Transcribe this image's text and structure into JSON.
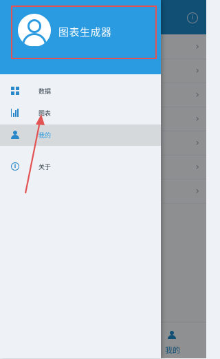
{
  "app": {
    "title": "图表生成器"
  },
  "drawer": {
    "items": [
      {
        "label": "数据",
        "icon": "grid-icon",
        "active": false
      },
      {
        "label": "图表",
        "icon": "bar-chart-icon",
        "active": false
      },
      {
        "label": "我的",
        "icon": "person-icon",
        "active": true
      },
      {
        "label": "关于",
        "icon": "info-icon",
        "active": false
      }
    ]
  },
  "background": {
    "top_icon": "info-icon",
    "bottom_tab": {
      "label": "我的",
      "icon": "person-icon"
    }
  },
  "colors": {
    "header_blue": "#2a9be0",
    "accent": "#2a87c8",
    "highlight_red": "#e25353",
    "overlay": "rgba(0,0,0,0.42)"
  }
}
